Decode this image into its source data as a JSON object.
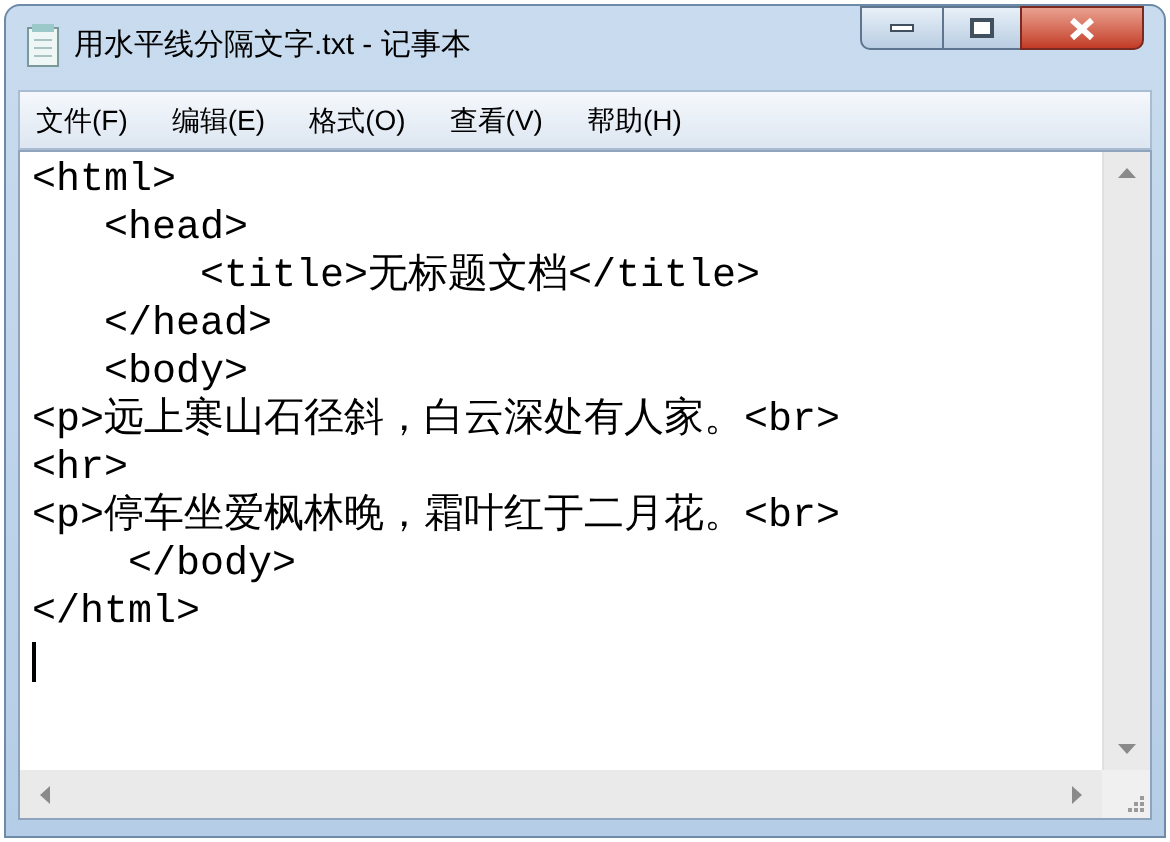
{
  "window": {
    "title": "用水平线分隔文字.txt - 记事本"
  },
  "menu": [
    {
      "label": "文件(F)"
    },
    {
      "label": "编辑(E)"
    },
    {
      "label": "格式(O)"
    },
    {
      "label": "查看(V)"
    },
    {
      "label": "帮助(H)"
    }
  ],
  "editor": {
    "lines": [
      "<html>",
      "   <head>",
      "       <title>无标题文档</title>",
      "   </head>",
      "   <body>",
      "<p>远上寒山石径斜，白云深处有人家。<br>",
      "<hr>",
      "<p>停车坐爱枫林晚，霜叶红于二月花。<br>",
      "    </body>",
      "</html>"
    ]
  }
}
